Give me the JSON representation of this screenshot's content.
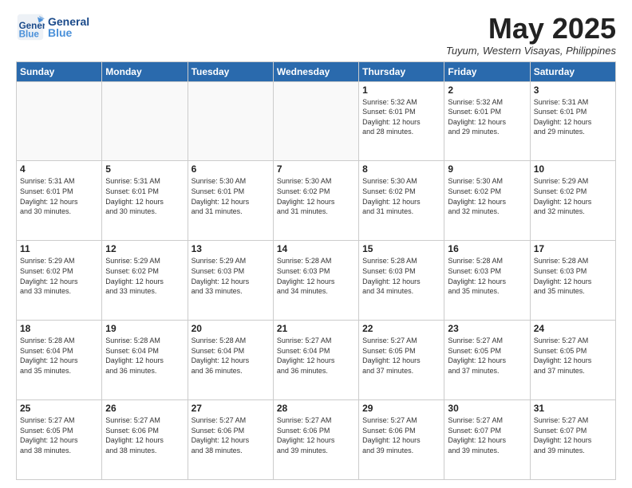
{
  "header": {
    "logo_general": "General",
    "logo_blue": "Blue",
    "month_year": "May 2025",
    "location": "Tuyum, Western Visayas, Philippines"
  },
  "weekdays": [
    "Sunday",
    "Monday",
    "Tuesday",
    "Wednesday",
    "Thursday",
    "Friday",
    "Saturday"
  ],
  "weeks": [
    [
      {
        "day": "",
        "info": ""
      },
      {
        "day": "",
        "info": ""
      },
      {
        "day": "",
        "info": ""
      },
      {
        "day": "",
        "info": ""
      },
      {
        "day": "1",
        "info": "Sunrise: 5:32 AM\nSunset: 6:01 PM\nDaylight: 12 hours\nand 28 minutes."
      },
      {
        "day": "2",
        "info": "Sunrise: 5:32 AM\nSunset: 6:01 PM\nDaylight: 12 hours\nand 29 minutes."
      },
      {
        "day": "3",
        "info": "Sunrise: 5:31 AM\nSunset: 6:01 PM\nDaylight: 12 hours\nand 29 minutes."
      }
    ],
    [
      {
        "day": "4",
        "info": "Sunrise: 5:31 AM\nSunset: 6:01 PM\nDaylight: 12 hours\nand 30 minutes."
      },
      {
        "day": "5",
        "info": "Sunrise: 5:31 AM\nSunset: 6:01 PM\nDaylight: 12 hours\nand 30 minutes."
      },
      {
        "day": "6",
        "info": "Sunrise: 5:30 AM\nSunset: 6:01 PM\nDaylight: 12 hours\nand 31 minutes."
      },
      {
        "day": "7",
        "info": "Sunrise: 5:30 AM\nSunset: 6:02 PM\nDaylight: 12 hours\nand 31 minutes."
      },
      {
        "day": "8",
        "info": "Sunrise: 5:30 AM\nSunset: 6:02 PM\nDaylight: 12 hours\nand 31 minutes."
      },
      {
        "day": "9",
        "info": "Sunrise: 5:30 AM\nSunset: 6:02 PM\nDaylight: 12 hours\nand 32 minutes."
      },
      {
        "day": "10",
        "info": "Sunrise: 5:29 AM\nSunset: 6:02 PM\nDaylight: 12 hours\nand 32 minutes."
      }
    ],
    [
      {
        "day": "11",
        "info": "Sunrise: 5:29 AM\nSunset: 6:02 PM\nDaylight: 12 hours\nand 33 minutes."
      },
      {
        "day": "12",
        "info": "Sunrise: 5:29 AM\nSunset: 6:02 PM\nDaylight: 12 hours\nand 33 minutes."
      },
      {
        "day": "13",
        "info": "Sunrise: 5:29 AM\nSunset: 6:03 PM\nDaylight: 12 hours\nand 33 minutes."
      },
      {
        "day": "14",
        "info": "Sunrise: 5:28 AM\nSunset: 6:03 PM\nDaylight: 12 hours\nand 34 minutes."
      },
      {
        "day": "15",
        "info": "Sunrise: 5:28 AM\nSunset: 6:03 PM\nDaylight: 12 hours\nand 34 minutes."
      },
      {
        "day": "16",
        "info": "Sunrise: 5:28 AM\nSunset: 6:03 PM\nDaylight: 12 hours\nand 35 minutes."
      },
      {
        "day": "17",
        "info": "Sunrise: 5:28 AM\nSunset: 6:03 PM\nDaylight: 12 hours\nand 35 minutes."
      }
    ],
    [
      {
        "day": "18",
        "info": "Sunrise: 5:28 AM\nSunset: 6:04 PM\nDaylight: 12 hours\nand 35 minutes."
      },
      {
        "day": "19",
        "info": "Sunrise: 5:28 AM\nSunset: 6:04 PM\nDaylight: 12 hours\nand 36 minutes."
      },
      {
        "day": "20",
        "info": "Sunrise: 5:28 AM\nSunset: 6:04 PM\nDaylight: 12 hours\nand 36 minutes."
      },
      {
        "day": "21",
        "info": "Sunrise: 5:27 AM\nSunset: 6:04 PM\nDaylight: 12 hours\nand 36 minutes."
      },
      {
        "day": "22",
        "info": "Sunrise: 5:27 AM\nSunset: 6:05 PM\nDaylight: 12 hours\nand 37 minutes."
      },
      {
        "day": "23",
        "info": "Sunrise: 5:27 AM\nSunset: 6:05 PM\nDaylight: 12 hours\nand 37 minutes."
      },
      {
        "day": "24",
        "info": "Sunrise: 5:27 AM\nSunset: 6:05 PM\nDaylight: 12 hours\nand 37 minutes."
      }
    ],
    [
      {
        "day": "25",
        "info": "Sunrise: 5:27 AM\nSunset: 6:05 PM\nDaylight: 12 hours\nand 38 minutes."
      },
      {
        "day": "26",
        "info": "Sunrise: 5:27 AM\nSunset: 6:06 PM\nDaylight: 12 hours\nand 38 minutes."
      },
      {
        "day": "27",
        "info": "Sunrise: 5:27 AM\nSunset: 6:06 PM\nDaylight: 12 hours\nand 38 minutes."
      },
      {
        "day": "28",
        "info": "Sunrise: 5:27 AM\nSunset: 6:06 PM\nDaylight: 12 hours\nand 39 minutes."
      },
      {
        "day": "29",
        "info": "Sunrise: 5:27 AM\nSunset: 6:06 PM\nDaylight: 12 hours\nand 39 minutes."
      },
      {
        "day": "30",
        "info": "Sunrise: 5:27 AM\nSunset: 6:07 PM\nDaylight: 12 hours\nand 39 minutes."
      },
      {
        "day": "31",
        "info": "Sunrise: 5:27 AM\nSunset: 6:07 PM\nDaylight: 12 hours\nand 39 minutes."
      }
    ]
  ]
}
